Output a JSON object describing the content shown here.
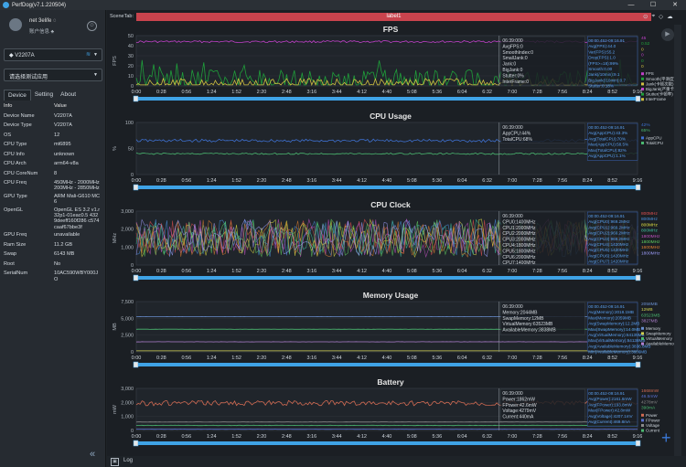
{
  "window": {
    "title": "PerfDog(v7.1.220504)",
    "min": "—",
    "max": "☐",
    "close": "✕"
  },
  "user": {
    "name": "net 3elife ◌",
    "sub": "账户信息 ♣",
    "logout": "⏻"
  },
  "device_select": {
    "value": "V2207A"
  },
  "app_select": {
    "value": "请选择测试应用"
  },
  "tabs": [
    "Device",
    "Setting",
    "About"
  ],
  "info_table": {
    "header": [
      "Info",
      "Value"
    ],
    "rows": [
      [
        "Device Name",
        "V2207A"
      ],
      [
        "Device Type",
        "V2207A"
      ],
      [
        "OS",
        "12"
      ],
      [
        "CPU Type",
        "mt6895"
      ],
      [
        "CPU Info",
        "unknown"
      ],
      [
        "CPU Arch",
        "arm64-v8a"
      ],
      [
        "CPU CoreNum",
        "8"
      ],
      [
        "CPU Freq",
        "450MHz - 2000MHz 200MHz - 2850MHz"
      ],
      [
        "GPU Type",
        "ARM Mali-G610 MC6"
      ],
      [
        "OpenGL",
        "OpenGL ES 3.2 v1.r32p1-01eac0.5 4329deeff160f286 c574caaf67bbe3f"
      ],
      [
        "GPU Freq",
        "unavailable"
      ],
      [
        "Ram Size",
        "11.2 GB"
      ],
      [
        "Swap",
        "6143 MB"
      ],
      [
        "Root",
        "No"
      ],
      [
        "SerialNum",
        "10AC590WBY000J O"
      ]
    ]
  },
  "scene": {
    "label": "SceneTab:",
    "bar_label": "label1",
    "icons": [
      "⊙",
      "⌖",
      "◇",
      "☁"
    ]
  },
  "time_axis": [
    "0:00",
    "0:28",
    "0:56",
    "1:24",
    "1:52",
    "2:20",
    "2:48",
    "3:16",
    "3:44",
    "4:12",
    "4:40",
    "5:08",
    "5:36",
    "6:04",
    "6:32",
    "7:00",
    "7:28",
    "7:56",
    "8:24",
    "8:52",
    "9:16"
  ],
  "charts": [
    {
      "title": "FPS",
      "ylabel": "FPS",
      "yticks": [
        "50",
        "40",
        "30",
        "20",
        "10",
        "0"
      ],
      "tip_left": [
        "06:39:000",
        "AvgFPS:0",
        "SmoothIndex:0",
        "SmallJank:0",
        "Jank:0",
        "BigJank:0",
        "Stutter:0%",
        "InterFrame:0"
      ],
      "tip_right": [
        "00:00.452-09:16.91",
        "Avg(FPS):44.0",
        "Var(FPS):55.2",
        "Drop(FPS):1.0",
        "(FPS>=18):99%",
        "Smooth:0.00",
        "Jank(/10min):9.1",
        "BigJank(/10min):0.7",
        "Stutter:0.18%"
      ],
      "values": [
        "45",
        "0.52",
        "0",
        "0",
        "0",
        "0"
      ],
      "legend": [
        "FPS",
        "Smooth(平滑度)",
        "Jank(卡顿次数)",
        "BigJank(严重卡顿)",
        "Stutter(卡顿率)",
        "InterFrame"
      ]
    },
    {
      "title": "CPU Usage",
      "ylabel": "%",
      "yticks": [
        "100",
        "50",
        "0"
      ],
      "tip_left": [
        "06:39:000",
        "AppCPU:44%",
        "TotalCPU:68%"
      ],
      "tip_right": [
        "00:00.452-09:16.91",
        "Avg(AppCPU):43.3%",
        "Avg(TotalCPU):70%",
        "Max(AppCPU):58.5%",
        "Max(TotalCPU):82%",
        "Avg(AppCPU):1.1%"
      ],
      "values": [
        "42%",
        "65%"
      ],
      "legend": [
        "AppCPU",
        "TotalCPU"
      ]
    },
    {
      "title": "CPU Clock",
      "ylabel": "MHz",
      "yticks": [
        "3,000",
        "2,000",
        "1,000",
        "0"
      ],
      "tip_left": [
        "06:39:000",
        "CPU0:1400MHz",
        "CPU1:2000MHz",
        "CPU2:2000MHz",
        "CPU3:2000MHz",
        "CPU4:1800MHz",
        "CPU5:1800MHz",
        "CPU6:2000MHz",
        "CPU7:1400MHz"
      ],
      "tip_right": [
        "00:00.452-09:16.91",
        "Avg(CPU0):969.2MHz",
        "Avg(CPU1):969.2MHz",
        "Avg(CPU2):969.2MHz",
        "Avg(CPU3):969.2MHz",
        "Avg(CPU4):1420MHz",
        "Avg(CPU5):1420MHz",
        "Avg(CPU6):1420MHz",
        "Avg(CPU7):1420MHz"
      ],
      "values": [
        "800MHz",
        "800MHz",
        "800MHz",
        "800MHz",
        "1800MHz",
        "1800MHz",
        "1600MHz",
        "1800MHz"
      ],
      "legend": []
    },
    {
      "title": "Memory Usage",
      "ylabel": "MB",
      "yticks": [
        "7,500",
        "5,000",
        "2,500",
        "0"
      ],
      "tip_left": [
        "06:39:000",
        "Memory:2044MB",
        "SwapMemory:12MB",
        "VirtualMemory:63523MB",
        "AvailableMemory:3838MB"
      ],
      "tip_right": [
        "00:00.452-09:16.91",
        "Avg(Memory):2018.1MB",
        "Max(Memory):2059MB",
        "Avg(SwapMemory):12.2MB",
        "Max(SwapMemory):14.0MB",
        "Avg(VirtualMemory):64135MB",
        "Max(VirtualMemory):64136MB",
        "Avg(AvailableMemory):3836.8MB",
        "Min(AvailableMemory):3606MB"
      ],
      "values": [
        "2058MB",
        "12MB",
        "63523MB",
        "3827MB"
      ],
      "legend": [
        "Memory",
        "SwapMemory",
        "VirtualMemory",
        "AvailableMemory"
      ]
    },
    {
      "title": "Battery",
      "ylabel": "mW",
      "yticks": [
        "3,000",
        "2,000",
        "1,000",
        "0"
      ],
      "tip_left": [
        "06:39:000",
        "Power:1862mW",
        "FPower:42.6mW",
        "Voltage:4279mV",
        "Current:440mA"
      ],
      "tip_right": [
        "00:00.452-09:16.91",
        "Avg(Power):2161.6mW",
        "Avg(FPower):193.8mW",
        "Max(FPower):42.8mW",
        "Avg(Voltage):4207.1mV",
        "Avg(Current):469.8mA"
      ],
      "values": [
        "1668mW",
        "46.5mW",
        "4278mV",
        "390mA"
      ],
      "legend": [
        "Power",
        "FPower",
        "Voltage",
        "Current"
      ]
    }
  ],
  "status": {
    "log_label": "Log",
    "log_check": "▣"
  },
  "colors": {
    "accent": "#3fa3e6",
    "scene_bar": "#c9434d",
    "fps": "#c040c8",
    "jank": "#1f9f3a",
    "cpu_app": "#3e70d0",
    "cpu_total": "#4ab870",
    "battery": "#d06a52"
  }
}
